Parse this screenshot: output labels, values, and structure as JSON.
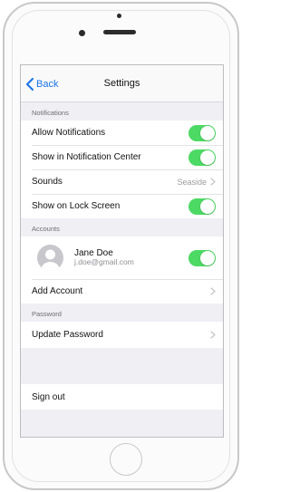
{
  "navbar": {
    "back_label": "Back",
    "title": "Settings"
  },
  "sections": {
    "notifications_header": "Notifications",
    "accounts_header": "Accounts",
    "password_header": "Password"
  },
  "notifications": [
    {
      "label": "Allow Notifications",
      "toggle": "on"
    },
    {
      "label": "Show in Notification Center",
      "toggle": "on"
    },
    {
      "label": "Sounds",
      "value": "Seaside"
    },
    {
      "label": "Show on Lock Screen",
      "toggle": "on"
    }
  ],
  "account": {
    "name": "Jane Doe",
    "email": "j.doe@gmail.com",
    "toggle": "on"
  },
  "add_account_label": "Add Account",
  "update_password_label": "Update Password",
  "sign_out_label": "Sign out",
  "colors": {
    "accent": "#1a73e8",
    "toggle_on": "#4cd964",
    "background": "#efeff4"
  },
  "icons": [
    "back-chevron-icon",
    "chevron-right-icon",
    "avatar-person-icon"
  ]
}
